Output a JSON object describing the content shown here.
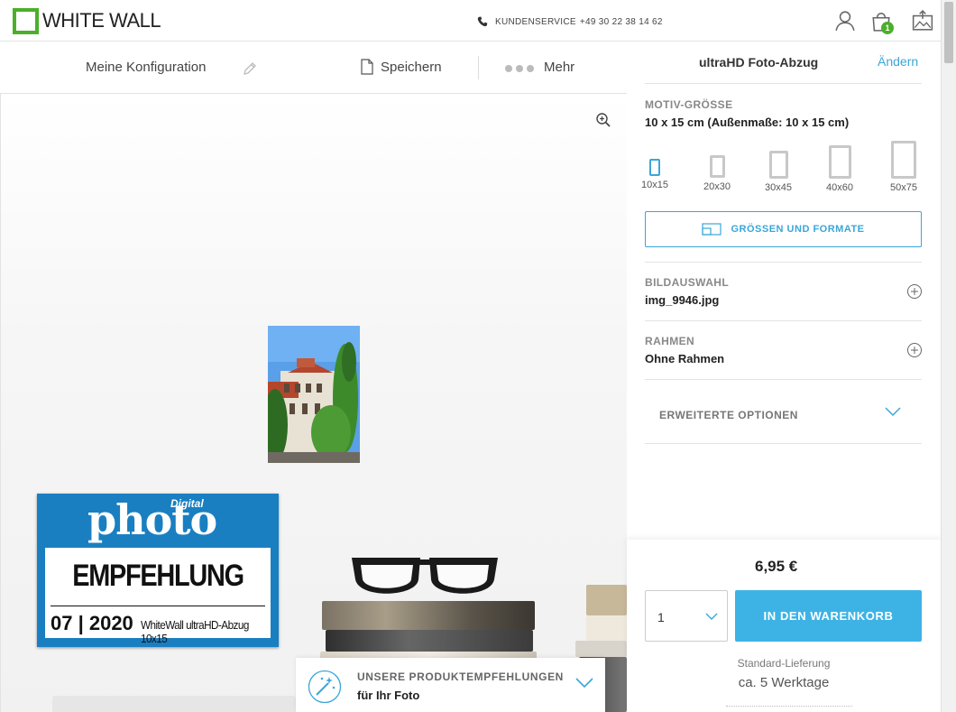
{
  "header": {
    "logo_text": "WHITE WALL",
    "hotline_label": "KUNDENSERVICE",
    "hotline_number": "+49 30 22 38 14 62",
    "cart_count": "1",
    "colors": {
      "brand_green": "#4caf2a",
      "accent_blue": "#3aa6d8"
    }
  },
  "toolbar": {
    "config_label": "Meine Konfiguration",
    "save_label": "Speichern",
    "more_label": "Mehr"
  },
  "scene": {
    "badge": {
      "digital": "Digital",
      "photo": "photo",
      "headline": "EMPFEHLUNG",
      "issue": "07 | 2020",
      "product": "WhiteWall ultraHD-Abzug 10x15"
    }
  },
  "recommendations": {
    "title": "UNSERE PRODUKTEMPFEHLUNGEN",
    "subtitle": "für Ihr Foto"
  },
  "panel": {
    "product_title": "ultraHD Foto-Abzug",
    "change_label": "Ändern",
    "size_label": "MOTIV-GRÖSSE",
    "size_value": "10 x 15 cm (Außenmaße: 10 x 15 cm)",
    "sizes": [
      "10x15",
      "20x30",
      "30x45",
      "40x60",
      "50x75"
    ],
    "selected_size": "10x15",
    "formats_button": "GRÖSSEN UND FORMATE",
    "image_label": "BILDAUSWAHL",
    "image_value": "img_9946.jpg",
    "frame_label": "RAHMEN",
    "frame_value": "Ohne Rahmen",
    "advanced_label": "ERWEITERTE OPTIONEN"
  },
  "purchase": {
    "price": "6,95 €",
    "quantity": "1",
    "cart_button": "IN DEN WARENKORB",
    "shipping_label": "Standard-Lieferung",
    "shipping_time": "ca. 5 Werktage"
  }
}
